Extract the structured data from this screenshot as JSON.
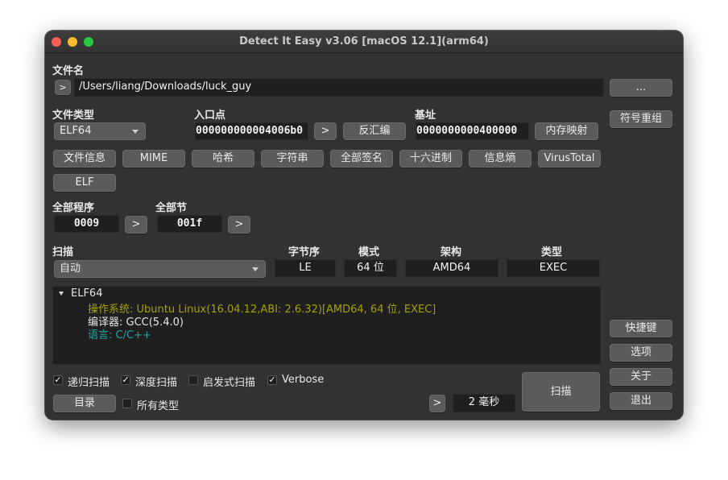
{
  "window": {
    "title": "Detect It Easy v3.06 [macOS 12.1](arm64)"
  },
  "file": {
    "label": "文件名",
    "expand_label": ">",
    "path": "/Users/liang/Downloads/luck_guy",
    "browse_label": "..."
  },
  "file_type": {
    "label": "文件类型",
    "selected": "ELF64"
  },
  "entry_point": {
    "label": "入口点",
    "value": "000000000004006b0",
    "go_label": ">",
    "disasm_label": "反汇编"
  },
  "base_address": {
    "label": "基址",
    "value": "0000000000400000",
    "memmap_label": "内存映射"
  },
  "side_buttons": {
    "rebuild_symbols": "符号重组",
    "shortcuts": "快捷键",
    "options": "选项",
    "about": "关于",
    "exit": "退出"
  },
  "toolbar": [
    "文件信息",
    "MIME",
    "哈希",
    "字符串",
    "全部签名",
    "十六进制",
    "信息熵",
    "VirusTotal"
  ],
  "elf_button": "ELF",
  "programs": {
    "label": "全部程序",
    "value": "0009",
    "go_label": ">"
  },
  "sections": {
    "label": "全部节",
    "value": "001f",
    "go_label": ">"
  },
  "scan": {
    "label": "扫描",
    "mode_selected": "自动",
    "columns": {
      "endianness": {
        "label": "字节序",
        "value": "LE"
      },
      "mode": {
        "label": "模式",
        "value": "64 位"
      },
      "arch": {
        "label": "架构",
        "value": "AMD64"
      },
      "type": {
        "label": "类型",
        "value": "EXEC"
      }
    }
  },
  "results": {
    "root": "ELF64",
    "os": "操作系统: Ubuntu Linux(16.04.12,ABI: 2.6.32)[AMD64, 64 位, EXEC]",
    "compiler": "编译器: GCC(5.4.0)",
    "language": "语言: C/C++",
    "colors": {
      "os": "#a6a000",
      "compiler": "#e6e6e6",
      "language": "#1fa6a6"
    }
  },
  "options": {
    "recursive": {
      "label": "递归扫描",
      "checked": true
    },
    "deep": {
      "label": "深度扫描",
      "checked": true
    },
    "heuristic": {
      "label": "启发式扫描",
      "checked": false
    },
    "verbose": {
      "label": "Verbose",
      "checked": true
    },
    "all_types": {
      "label": "所有类型",
      "checked": false
    }
  },
  "bottom": {
    "directory_label": "目录",
    "time_go_label": ">",
    "time_value": "2 毫秒",
    "scan_button": "扫描"
  },
  "check_glyph": "✓"
}
